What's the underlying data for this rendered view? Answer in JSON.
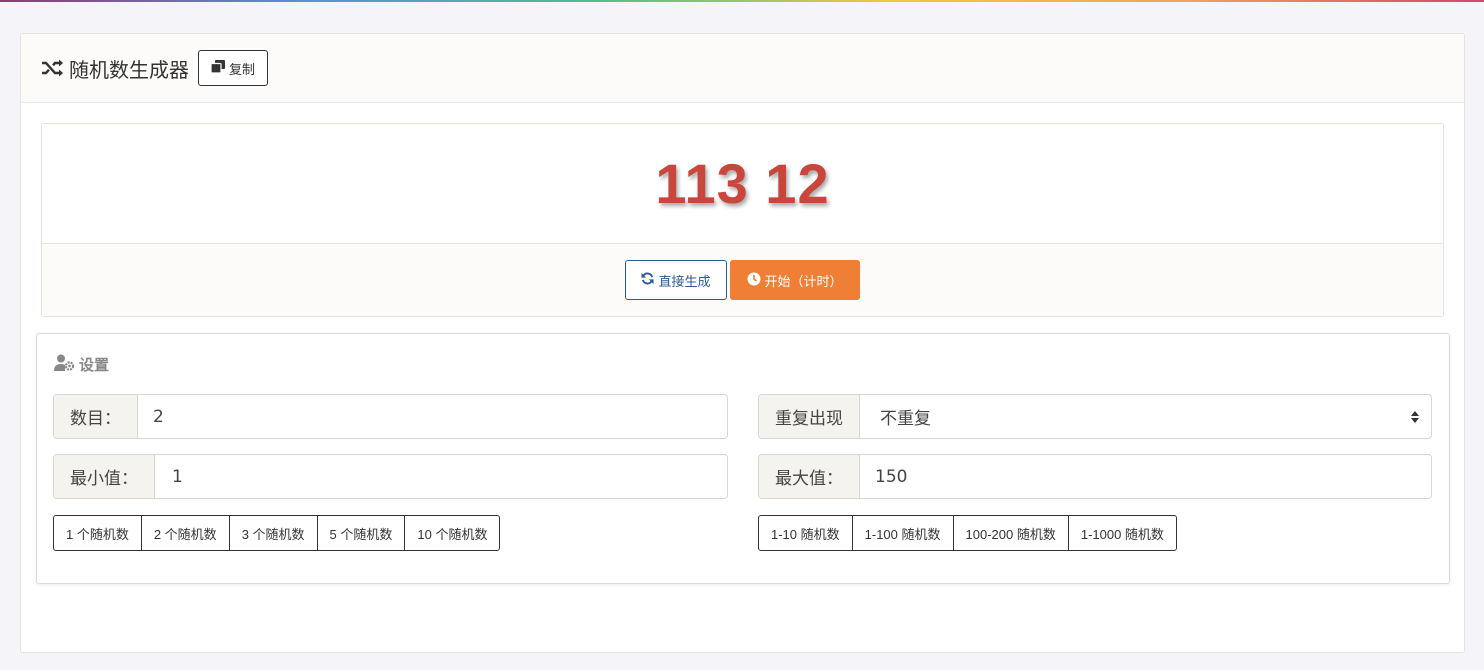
{
  "header": {
    "title": "随机数生成器",
    "copy_label": "复制",
    "title_icon": "shuffle-icon",
    "copy_icon": "copy-icon"
  },
  "result": {
    "value": "113 12",
    "color": "#c9463d",
    "generate_label": "直接生成",
    "generate_icon": "refresh-icon",
    "start_label": "开始（计时）",
    "start_icon": "clock-icon",
    "accent_blue": "#2c5b9a",
    "accent_orange": "#ee7f34"
  },
  "settings": {
    "title": "设置",
    "title_icon": "user-cog-icon",
    "count": {
      "label": "数目：",
      "value": "2"
    },
    "repeat": {
      "label": "重复出现",
      "selected": "不重复"
    },
    "min": {
      "label": "最小值：",
      "value": "1"
    },
    "max": {
      "label": "最大值：",
      "value": "150"
    },
    "count_presets": [
      "1 个随机数",
      "2 个随机数",
      "3 个随机数",
      "5 个随机数",
      "10 个随机数"
    ],
    "range_presets": [
      "1-10 随机数",
      "1-100 随机数",
      "100-200 随机数",
      "1-1000 随机数"
    ]
  }
}
